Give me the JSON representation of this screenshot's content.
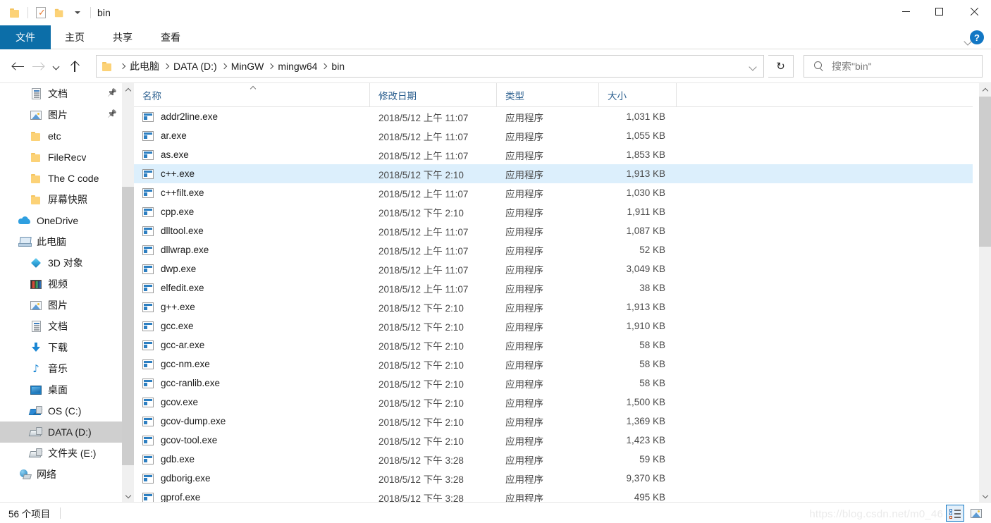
{
  "window": {
    "title": "bin",
    "quick_access": [
      {
        "name": "folder-icon",
        "label": ""
      },
      {
        "name": "properties-icon",
        "label": ""
      },
      {
        "name": "new-folder-icon",
        "label": ""
      },
      {
        "name": "customize-caret-icon",
        "label": ""
      }
    ],
    "controls": {
      "minimize": "minimize-icon",
      "maximize": "maximize-icon",
      "close": "close-icon"
    }
  },
  "ribbon": {
    "file_tab": "文件",
    "tabs": [
      "主页",
      "共享",
      "查看"
    ],
    "expand_icon": "chevron-down-icon",
    "help_label": "?"
  },
  "navigation": {
    "back_icon": "back-arrow-icon",
    "forward_icon": "forward-arrow-icon",
    "recent_icon": "recent-locations-icon",
    "up_icon": "up-arrow-icon",
    "breadcrumbs": [
      "此电脑",
      "DATA (D:)",
      "MinGW",
      "mingw64",
      "bin"
    ],
    "dropdown_icon": "chevron-down-icon",
    "refresh_icon": "refresh-icon"
  },
  "search": {
    "icon": "search-icon",
    "placeholder": "搜索\"bin\"",
    "value": ""
  },
  "sidebar": {
    "items": [
      {
        "label": "文档",
        "icon": "document-icon",
        "indent": 1,
        "pinned": true,
        "selected": false
      },
      {
        "label": "图片",
        "icon": "pictures-icon",
        "indent": 1,
        "pinned": true,
        "selected": false
      },
      {
        "label": "etc",
        "icon": "folder-icon",
        "indent": 1,
        "pinned": false,
        "selected": false
      },
      {
        "label": "FileRecv",
        "icon": "folder-icon",
        "indent": 1,
        "pinned": false,
        "selected": false
      },
      {
        "label": "The C code",
        "icon": "folder-icon",
        "indent": 1,
        "pinned": false,
        "selected": false
      },
      {
        "label": "屏幕快照",
        "icon": "folder-icon",
        "indent": 1,
        "pinned": false,
        "selected": false
      },
      {
        "label": "OneDrive",
        "icon": "onedrive-icon",
        "indent": 0,
        "pinned": false,
        "selected": false
      },
      {
        "label": "此电脑",
        "icon": "this-pc-icon",
        "indent": 0,
        "pinned": false,
        "selected": false
      },
      {
        "label": "3D 对象",
        "icon": "3d-objects-icon",
        "indent": 1,
        "pinned": false,
        "selected": false
      },
      {
        "label": "视频",
        "icon": "videos-icon",
        "indent": 1,
        "pinned": false,
        "selected": false
      },
      {
        "label": "图片",
        "icon": "pictures-icon",
        "indent": 1,
        "pinned": false,
        "selected": false
      },
      {
        "label": "文档",
        "icon": "document-icon",
        "indent": 1,
        "pinned": false,
        "selected": false
      },
      {
        "label": "下载",
        "icon": "downloads-icon",
        "indent": 1,
        "pinned": false,
        "selected": false
      },
      {
        "label": "音乐",
        "icon": "music-icon",
        "indent": 1,
        "pinned": false,
        "selected": false
      },
      {
        "label": "桌面",
        "icon": "desktop-icon",
        "indent": 1,
        "pinned": false,
        "selected": false
      },
      {
        "label": "OS (C:)",
        "icon": "os-drive-icon",
        "indent": 1,
        "pinned": false,
        "selected": false
      },
      {
        "label": "DATA (D:)",
        "icon": "drive-icon",
        "indent": 1,
        "pinned": false,
        "selected": true
      },
      {
        "label": "文件夹 (E:)",
        "icon": "drive-icon",
        "indent": 1,
        "pinned": false,
        "selected": false
      },
      {
        "label": "网络",
        "icon": "network-icon",
        "indent": 0,
        "pinned": false,
        "selected": false
      }
    ]
  },
  "file_list": {
    "columns": [
      {
        "key": "name",
        "label": "名称",
        "sorted": true
      },
      {
        "key": "date",
        "label": "修改日期",
        "sorted": false
      },
      {
        "key": "type",
        "label": "类型",
        "sorted": false
      },
      {
        "key": "size",
        "label": "大小",
        "sorted": false
      }
    ],
    "sort_indicator": "sort-ascending-icon",
    "rows": [
      {
        "name": "addr2line.exe",
        "date": "2018/5/12 上午 11:07",
        "type": "应用程序",
        "size": "1,031 KB",
        "icon": "exe-icon",
        "selected": false
      },
      {
        "name": "ar.exe",
        "date": "2018/5/12 上午 11:07",
        "type": "应用程序",
        "size": "1,055 KB",
        "icon": "exe-icon",
        "selected": false
      },
      {
        "name": "as.exe",
        "date": "2018/5/12 上午 11:07",
        "type": "应用程序",
        "size": "1,853 KB",
        "icon": "exe-icon",
        "selected": false
      },
      {
        "name": "c++.exe",
        "date": "2018/5/12 下午 2:10",
        "type": "应用程序",
        "size": "1,913 KB",
        "icon": "exe-icon",
        "selected": true
      },
      {
        "name": "c++filt.exe",
        "date": "2018/5/12 上午 11:07",
        "type": "应用程序",
        "size": "1,030 KB",
        "icon": "exe-icon",
        "selected": false
      },
      {
        "name": "cpp.exe",
        "date": "2018/5/12 下午 2:10",
        "type": "应用程序",
        "size": "1,911 KB",
        "icon": "exe-icon",
        "selected": false
      },
      {
        "name": "dlltool.exe",
        "date": "2018/5/12 上午 11:07",
        "type": "应用程序",
        "size": "1,087 KB",
        "icon": "exe-icon",
        "selected": false
      },
      {
        "name": "dllwrap.exe",
        "date": "2018/5/12 上午 11:07",
        "type": "应用程序",
        "size": "52 KB",
        "icon": "exe-icon",
        "selected": false
      },
      {
        "name": "dwp.exe",
        "date": "2018/5/12 上午 11:07",
        "type": "应用程序",
        "size": "3,049 KB",
        "icon": "exe-icon",
        "selected": false
      },
      {
        "name": "elfedit.exe",
        "date": "2018/5/12 上午 11:07",
        "type": "应用程序",
        "size": "38 KB",
        "icon": "exe-icon",
        "selected": false
      },
      {
        "name": "g++.exe",
        "date": "2018/5/12 下午 2:10",
        "type": "应用程序",
        "size": "1,913 KB",
        "icon": "exe-icon",
        "selected": false
      },
      {
        "name": "gcc.exe",
        "date": "2018/5/12 下午 2:10",
        "type": "应用程序",
        "size": "1,910 KB",
        "icon": "exe-icon",
        "selected": false
      },
      {
        "name": "gcc-ar.exe",
        "date": "2018/5/12 下午 2:10",
        "type": "应用程序",
        "size": "58 KB",
        "icon": "exe-icon",
        "selected": false
      },
      {
        "name": "gcc-nm.exe",
        "date": "2018/5/12 下午 2:10",
        "type": "应用程序",
        "size": "58 KB",
        "icon": "exe-icon",
        "selected": false
      },
      {
        "name": "gcc-ranlib.exe",
        "date": "2018/5/12 下午 2:10",
        "type": "应用程序",
        "size": "58 KB",
        "icon": "exe-icon",
        "selected": false
      },
      {
        "name": "gcov.exe",
        "date": "2018/5/12 下午 2:10",
        "type": "应用程序",
        "size": "1,500 KB",
        "icon": "exe-icon",
        "selected": false
      },
      {
        "name": "gcov-dump.exe",
        "date": "2018/5/12 下午 2:10",
        "type": "应用程序",
        "size": "1,369 KB",
        "icon": "exe-icon",
        "selected": false
      },
      {
        "name": "gcov-tool.exe",
        "date": "2018/5/12 下午 2:10",
        "type": "应用程序",
        "size": "1,423 KB",
        "icon": "exe-icon",
        "selected": false
      },
      {
        "name": "gdb.exe",
        "date": "2018/5/12 下午 3:28",
        "type": "应用程序",
        "size": "59 KB",
        "icon": "exe-icon",
        "selected": false
      },
      {
        "name": "gdborig.exe",
        "date": "2018/5/12 下午 3:28",
        "type": "应用程序",
        "size": "9,370 KB",
        "icon": "exe-icon",
        "selected": false
      },
      {
        "name": "gprof.exe",
        "date": "2018/5/12 下午 3:28",
        "type": "应用程序",
        "size": "495 KB",
        "icon": "exe-icon",
        "selected": false
      }
    ]
  },
  "statusbar": {
    "item_count": "56 个项目",
    "view_details_icon": "details-view-icon",
    "view_thumbnails_icon": "large-icons-view-icon"
  },
  "watermark": {
    "text": "https://blog.csdn.net/m0_46"
  },
  "colors": {
    "accent": "#0c6ea8",
    "selection": "#dceffc",
    "sidebar_selection": "#cfcfcf",
    "column_header_text": "#2b5f8f"
  }
}
